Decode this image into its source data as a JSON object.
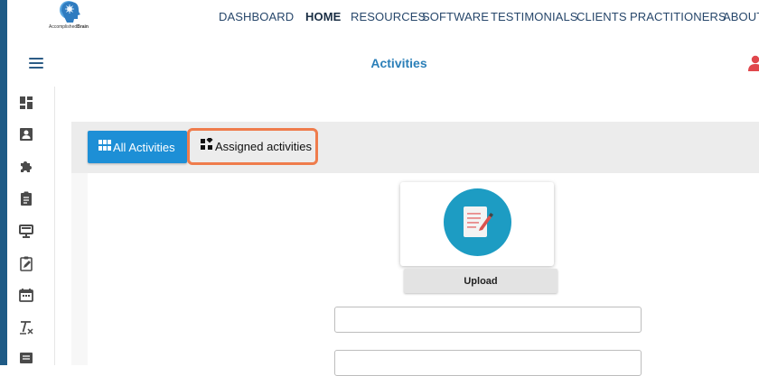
{
  "brand": {
    "logo_icon": "brain-head-icon",
    "logo_text_prefix": "Accomplished",
    "logo_text_bold": "Brain"
  },
  "nav": {
    "items": [
      {
        "label": "DASHBOARD",
        "active": false
      },
      {
        "label": "HOME",
        "active": true
      },
      {
        "label": "RESOURCES",
        "active": false
      },
      {
        "label": "SOFTWARE",
        "active": false
      },
      {
        "label": "TESTIMONIALS",
        "active": false
      },
      {
        "label": "CLIENTS",
        "active": false
      },
      {
        "label": "PRACTITIONERS",
        "active": false
      },
      {
        "label": "ABOUT",
        "active": false
      }
    ]
  },
  "header": {
    "title": "Activities",
    "menu_icon": "hamburger-menu-icon",
    "user_icon": "user-icon"
  },
  "sidebar": {
    "icons": [
      "dashboard-icon",
      "contact-card-icon",
      "puzzle-icon",
      "clipboard-icon",
      "monitor-icon",
      "clipboard-edit-icon",
      "calendar-icon",
      "clear-format-icon",
      "message-icon"
    ]
  },
  "tabs": {
    "all_label": "All Activities",
    "all_icon": "grid-view-icon",
    "assigned_label": "Assigned activities",
    "assigned_icon": "widgets-icon"
  },
  "upload": {
    "icon": "document-edit-icon",
    "button_label": "Upload"
  },
  "form": {
    "field_1_value": "",
    "field_2_value": ""
  },
  "colors": {
    "accent": "#1d8fd6",
    "title": "#2b7fb8",
    "highlight": "#ef7c4c",
    "user": "#e0474c"
  }
}
